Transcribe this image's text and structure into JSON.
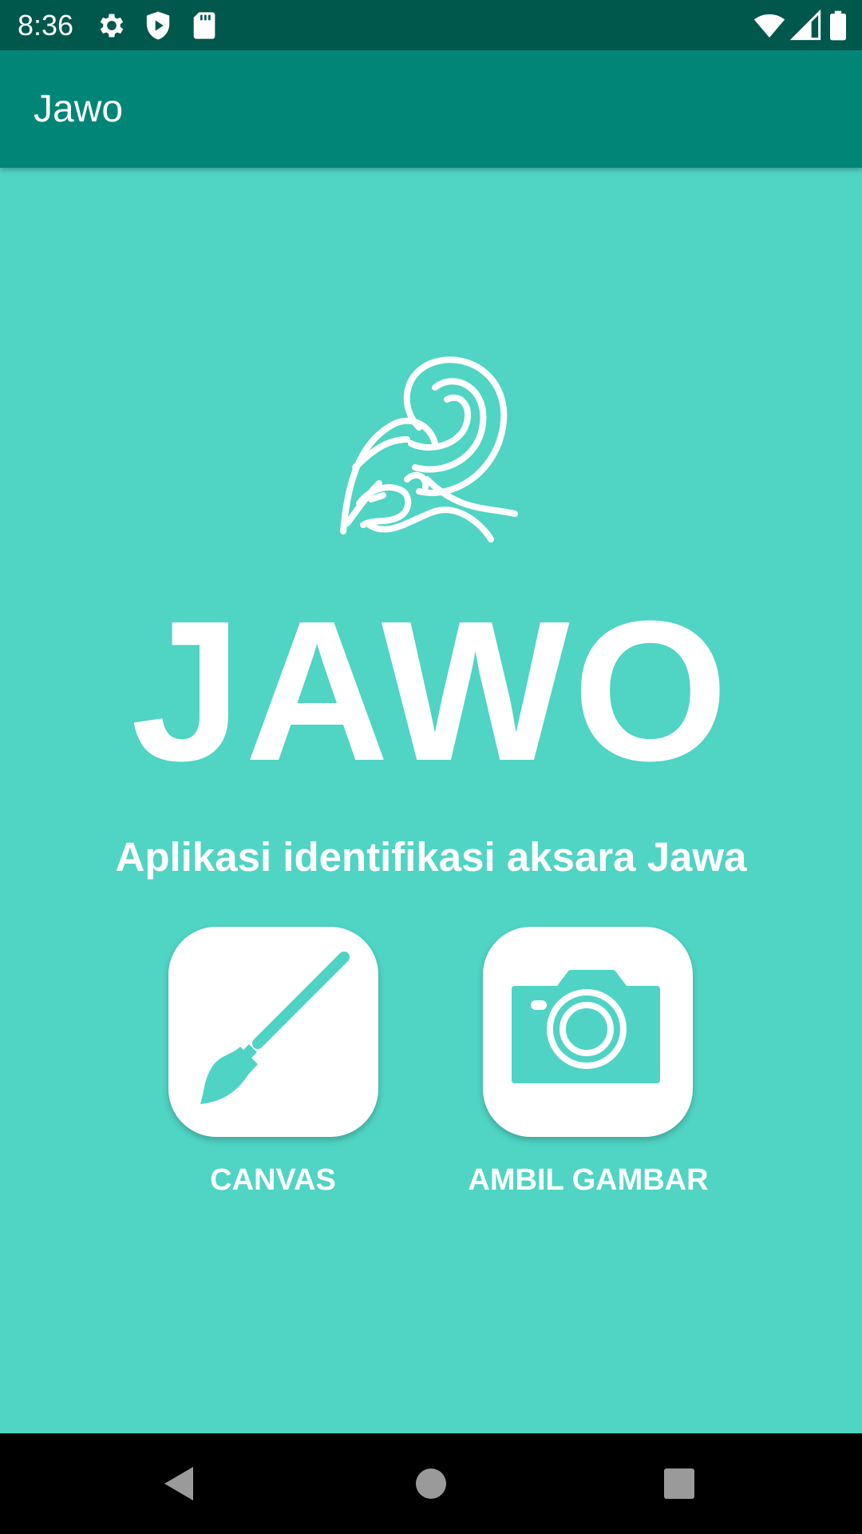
{
  "status_bar": {
    "time": "8:36",
    "left_icons": [
      "gear-icon",
      "shield-icon",
      "sd-card-icon"
    ],
    "right_icons": [
      "wifi-icon",
      "cell-signal-icon",
      "battery-icon"
    ]
  },
  "app_bar": {
    "title": "Jawo"
  },
  "main": {
    "logo_icon": "wayang-logo-icon",
    "title": "JAWO",
    "subtitle": "Aplikasi identifikasi aksara Jawa",
    "actions": [
      {
        "label": "CANVAS",
        "icon": "paintbrush-icon"
      },
      {
        "label": "AMBIL GAMBAR",
        "icon": "camera-icon"
      }
    ]
  },
  "nav_bar": {
    "buttons": [
      "back-icon",
      "home-icon",
      "recents-icon"
    ]
  },
  "colors": {
    "status_bar": "#00574B",
    "app_bar": "#008577",
    "background": "#50D4C4",
    "accent": "#4FD3C4",
    "text": "#FFFFFF"
  }
}
